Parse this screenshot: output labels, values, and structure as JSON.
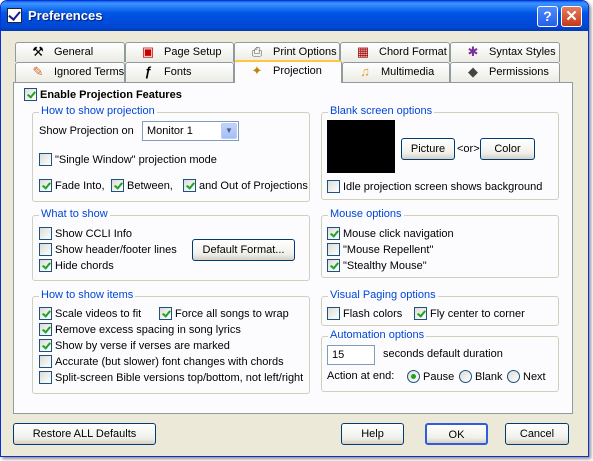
{
  "window": {
    "title": "Preferences",
    "help_glyph": "?",
    "close_glyph": "✕"
  },
  "tabs": {
    "general": {
      "label": "General",
      "icon": "wrench-icon",
      "glyph": "⚒"
    },
    "page_setup": {
      "label": "Page Setup",
      "icon": "page-setup-icon",
      "glyph": "▣"
    },
    "print_options": {
      "label": "Print Options",
      "icon": "printer-icon",
      "glyph": "⎙"
    },
    "chord_format": {
      "label": "Chord Format",
      "icon": "chord-format-icon",
      "glyph": "▦"
    },
    "syntax_styles": {
      "label": "Syntax Styles",
      "icon": "syntax-styles-icon",
      "glyph": "✱"
    },
    "ignored_terms": {
      "label": "Ignored Terms",
      "icon": "eraser-icon",
      "glyph": "✎"
    },
    "fonts": {
      "label": "Fonts",
      "icon": "font-icon",
      "glyph": "ƒ"
    },
    "projection": {
      "label": "Projection",
      "icon": "projector-icon",
      "glyph": "✦"
    },
    "multimedia": {
      "label": "Multimedia",
      "icon": "music-note-icon",
      "glyph": "♫"
    },
    "permissions": {
      "label": "Permissions",
      "icon": "tag-icon",
      "glyph": "◆"
    }
  },
  "enable": {
    "label": "Enable Projection Features",
    "checked": true
  },
  "how_to_show_projection": {
    "title": "How to show projection",
    "show_on_label": "Show Projection on",
    "monitor_value": "Monitor 1",
    "single_window": {
      "label": "\"Single Window\" projection mode",
      "checked": false
    },
    "fade_into": {
      "label": "Fade Into,",
      "checked": true
    },
    "between": {
      "label": "Between,",
      "checked": true
    },
    "and_out": {
      "label": "and Out of Projections",
      "checked": true
    }
  },
  "what_to_show": {
    "title": "What to show",
    "ccli": {
      "label": "Show CCLI Info",
      "checked": false
    },
    "header_footer": {
      "label": "Show header/footer lines",
      "checked": false
    },
    "hide_chords": {
      "label": "Hide chords",
      "checked": true
    },
    "default_format_button": "Default Format..."
  },
  "how_to_show_items": {
    "title": "How to show items",
    "scale_videos": {
      "label": "Scale videos to fit",
      "checked": true
    },
    "force_wrap": {
      "label": "Force all songs to wrap",
      "checked": true
    },
    "remove_spacing": {
      "label": "Remove excess spacing in song lyrics",
      "checked": true
    },
    "show_by_verse": {
      "label": "Show by verse if verses are marked",
      "checked": true
    },
    "accurate_font": {
      "label": "Accurate (but slower) font changes with chords",
      "checked": false
    },
    "split_screen": {
      "label": "Split-screen Bible versions top/bottom, not left/right",
      "checked": false
    }
  },
  "blank_screen": {
    "title": "Blank screen options",
    "picture_button": "Picture",
    "or_text": "<or>",
    "color_button": "Color",
    "idle": {
      "label": "Idle projection screen shows background",
      "checked": false
    }
  },
  "mouse_options": {
    "title": "Mouse options",
    "click_nav": {
      "label": "Mouse click navigation",
      "checked": true
    },
    "repellent": {
      "label": "\"Mouse Repellent\"",
      "checked": false
    },
    "stealthy": {
      "label": "\"Stealthy Mouse\"",
      "checked": true
    }
  },
  "visual_paging": {
    "title": "Visual Paging options",
    "flash_colors": {
      "label": "Flash colors",
      "checked": false
    },
    "fly_center": {
      "label": "Fly center to corner",
      "checked": true
    }
  },
  "automation": {
    "title": "Automation options",
    "seconds_value": "15",
    "seconds_label": "seconds default duration",
    "action_label": "Action at end:",
    "pause": {
      "label": "Pause",
      "checked": true
    },
    "blank": {
      "label": "Blank",
      "checked": false
    },
    "next": {
      "label": "Next",
      "checked": false
    }
  },
  "footer": {
    "restore_button": "Restore ALL Defaults",
    "help_button": "Help",
    "ok_button": "OK",
    "cancel_button": "Cancel"
  },
  "colors": {
    "group_title": "#0046d5",
    "check": "#21a121",
    "titlebar": "#0055e5"
  }
}
